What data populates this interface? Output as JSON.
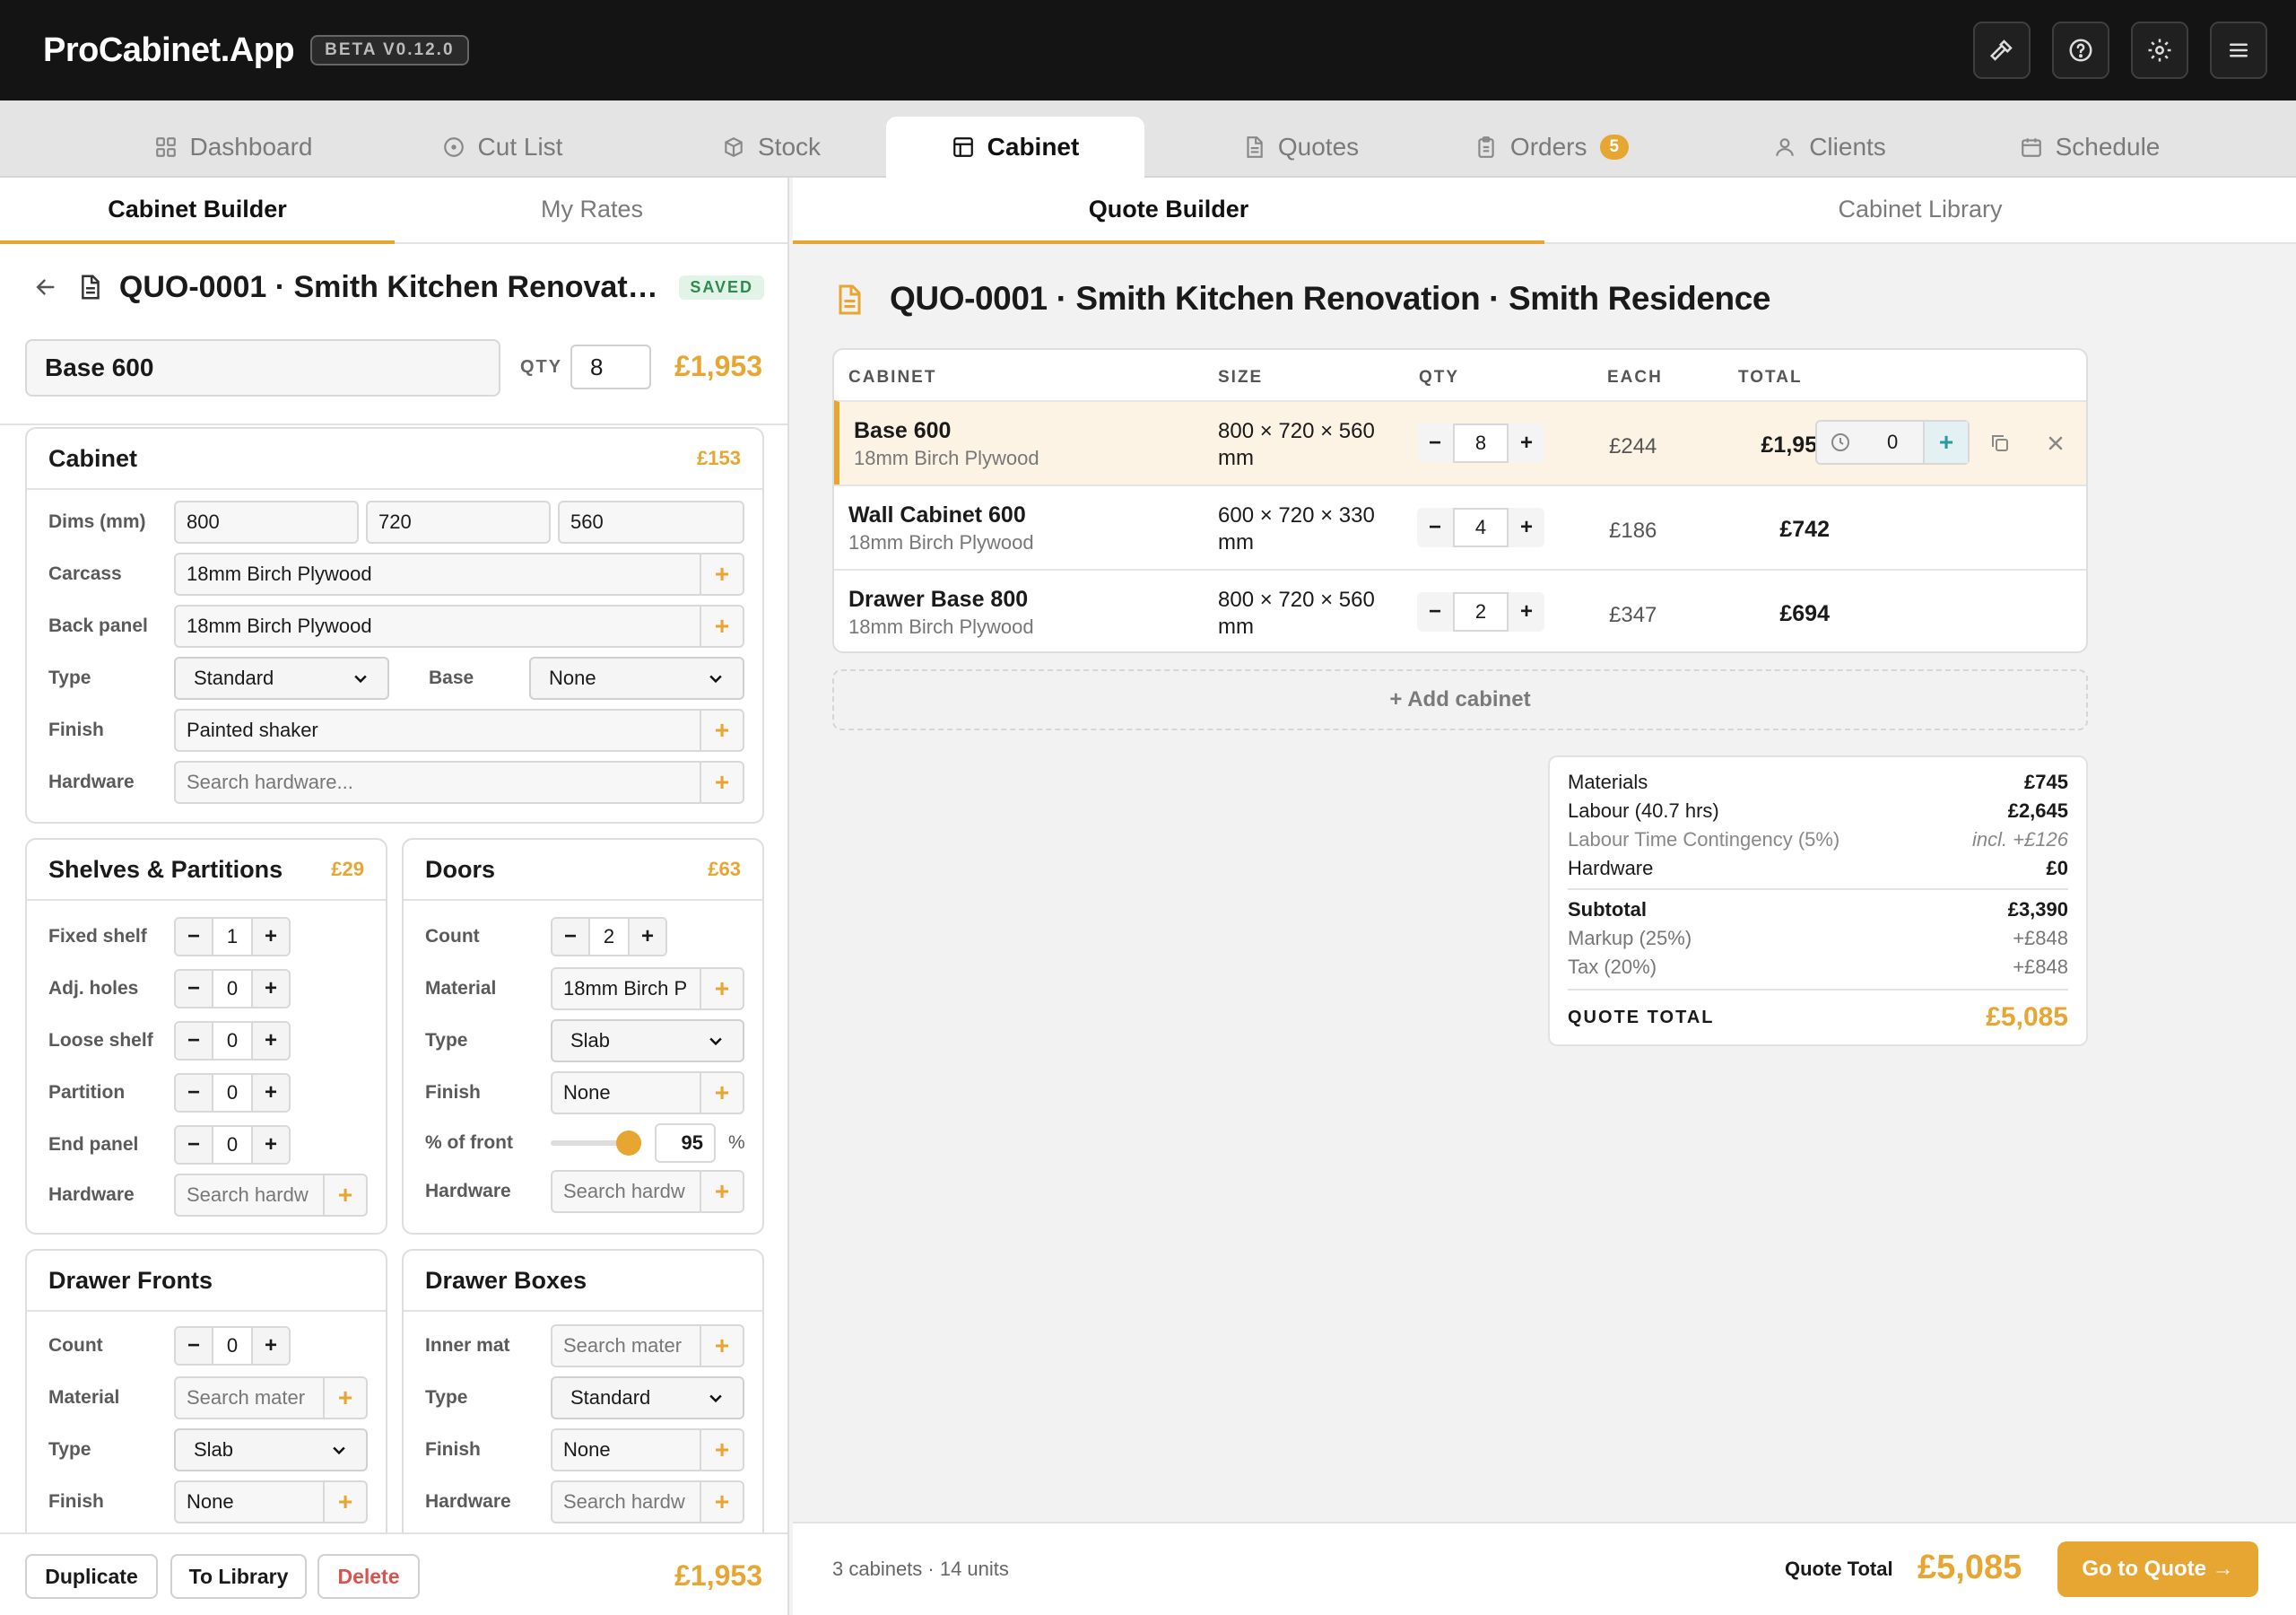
{
  "app": {
    "title": "ProCabinet.App",
    "version": "BETA V0.12.0"
  },
  "top_icons": [
    "hammer-icon",
    "help-icon",
    "gear-icon",
    "menu-icon"
  ],
  "nav": {
    "tabs": [
      {
        "label": "Dashboard",
        "icon": "grid-icon"
      },
      {
        "label": "Cut List",
        "icon": "target-icon"
      },
      {
        "label": "Stock",
        "icon": "box-icon"
      },
      {
        "label": "Cabinet",
        "icon": "layout-icon",
        "active": true
      },
      {
        "label": "Quotes",
        "icon": "document-icon"
      },
      {
        "label": "Orders",
        "icon": "clipboard-icon",
        "badge": "5"
      },
      {
        "label": "Clients",
        "icon": "user-icon"
      },
      {
        "label": "Schedule",
        "icon": "calendar-icon"
      }
    ]
  },
  "left": {
    "tabs": [
      "Cabinet Builder",
      "My Rates"
    ],
    "header_title": "QUO-0001 · Smith Kitchen Renovatio...",
    "saved": "SAVED",
    "cabinet_name": "Base 600",
    "qty_label": "QTY",
    "qty": "8",
    "price": "£1,953",
    "cabinet_card": {
      "title": "Cabinet",
      "price": "£153",
      "dims_label": "Dims (mm)",
      "dims": [
        "800",
        "720",
        "560"
      ],
      "carcass_label": "Carcass",
      "carcass": "18mm Birch Plywood",
      "back_label": "Back panel",
      "back": "18mm Birch Plywood",
      "type_label": "Type",
      "type": "Standard",
      "base_label": "Base",
      "base": "None",
      "finish_label": "Finish",
      "finish": "Painted shaker",
      "hardware_label": "Hardware",
      "hardware_ph": "Search hardware..."
    },
    "shelves": {
      "title": "Shelves & Partitions",
      "price": "£29",
      "rows": [
        {
          "label": "Fixed shelf",
          "value": "1"
        },
        {
          "label": "Adj. holes",
          "value": "0"
        },
        {
          "label": "Loose shelf",
          "value": "0"
        },
        {
          "label": "Partition",
          "value": "0"
        },
        {
          "label": "End panel",
          "value": "0"
        }
      ],
      "hardware_label": "Hardware",
      "hardware_ph": "Search hardw"
    },
    "doors": {
      "title": "Doors",
      "price": "£63",
      "count_label": "Count",
      "count": "2",
      "material_label": "Material",
      "material": "18mm Birch P",
      "type_label": "Type",
      "type": "Slab",
      "finish_label": "Finish",
      "finish": "None",
      "front_label": "% of front",
      "front_value": "95",
      "front_fraction": 0.95,
      "front_unit": "%",
      "hardware_label": "Hardware",
      "hardware_ph": "Search hardw"
    },
    "drawer_fronts": {
      "title": "Drawer Fronts",
      "count_label": "Count",
      "count": "0",
      "material_label": "Material",
      "material_ph": "Search mater",
      "type_label": "Type",
      "type": "Slab",
      "finish_label": "Finish",
      "finish": "None"
    },
    "drawer_boxes": {
      "title": "Drawer Boxes",
      "inner_label": "Inner mat",
      "inner_ph": "Search mater",
      "type_label": "Type",
      "type": "Standard",
      "finish_label": "Finish",
      "finish": "None",
      "hardware_label": "Hardware",
      "hardware_ph": "Search hardw"
    },
    "footer": {
      "duplicate": "Duplicate",
      "library": "To Library",
      "delete": "Delete",
      "price": "£1,953"
    }
  },
  "right": {
    "tabs": [
      "Quote Builder",
      "Cabinet Library"
    ],
    "quote_title": "QUO-0001 · Smith Kitchen Renovation · Smith Residence",
    "columns": [
      "CABINET",
      "SIZE",
      "QTY",
      "EACH",
      "TOTAL"
    ],
    "rows": [
      {
        "name": "Base 600",
        "material": "18mm Birch Plywood",
        "size": "800 × 720 × 560 mm",
        "qty": "8",
        "each": "£244",
        "total": "£1,953",
        "extra": "0"
      },
      {
        "name": "Wall Cabinet 600",
        "material": "18mm Birch Plywood",
        "size": "600 × 720 × 330 mm",
        "qty": "4",
        "each": "£186",
        "total": "£742"
      },
      {
        "name": "Drawer Base 800",
        "material": "18mm Birch Plywood",
        "size": "800 × 720 × 560 mm",
        "qty": "2",
        "each": "£347",
        "total": "£694"
      }
    ],
    "add_cabinet": "+ Add cabinet",
    "summary": {
      "materials_label": "Materials",
      "materials": "£745",
      "labour_label": "Labour (40.7 hrs)",
      "labour": "£2,645",
      "contingency_label": "Labour Time Contingency (5%)",
      "contingency": "incl. +£126",
      "hardware_label": "Hardware",
      "hardware": "£0",
      "subtotal_label": "Subtotal",
      "subtotal": "£3,390",
      "markup_label": "Markup (25%)",
      "markup": "+£848",
      "tax_label": "Tax (20%)",
      "tax": "+£848",
      "total_label": "QUOTE TOTAL",
      "total": "£5,085"
    },
    "footer": {
      "count": "3 cabinets · 14 units",
      "total_label": "Quote Total",
      "total": "£5,085",
      "go": "Go to Quote →"
    }
  },
  "colors": {
    "accent": "#e7a532",
    "dark": "#141414",
    "saved_green": "#2e8a4f",
    "delete_red": "#d9534f"
  }
}
